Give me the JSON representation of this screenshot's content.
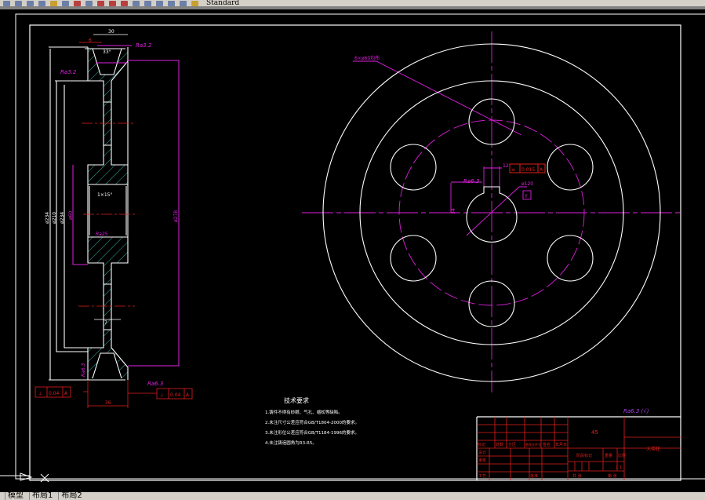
{
  "toolbar": {
    "layer_text": "Standard"
  },
  "tabs": [
    "模型",
    "布局1",
    "布局2"
  ],
  "colors": {
    "white": "#ffffff",
    "magenta": "#e020e0",
    "red": "#e0201c",
    "cyan": "#40e0d0",
    "centerline": "#e0201c",
    "background": "#000000"
  },
  "section_view": {
    "dims": {
      "width_top": "30",
      "groove_offset": "6",
      "groove_angle": "33°",
      "web": "7",
      "width_bottom": "36",
      "bore_chamfer": "1×15°",
      "d1": "ø234",
      "d2": "ø210",
      "d3": "ø234",
      "d4": "ø60",
      "d5": "ø278"
    },
    "roughness": {
      "top_right": "Ra3.2",
      "left": "Ra3.2",
      "bore": "Ra25",
      "groove_left": "Ra6.3",
      "bottom_right": "Ra6.3"
    },
    "tolerance_left": {
      "symbol": "⊥",
      "value": "0.04",
      "datum": "A"
    },
    "tolerance_right": {
      "symbol": "⊥",
      "value": "0.04",
      "datum": "A"
    }
  },
  "front_view": {
    "hole_note": "6×ø60均布",
    "keyway_width": "12",
    "keyway_tolerance": {
      "symbol": "≡",
      "value": "0.015",
      "datum": "A"
    },
    "keyway_depth": "34",
    "bore_roughness": "Ra6.3",
    "bore_dia": "ø120",
    "datum": "Y"
  },
  "notes": {
    "title": "技术要求",
    "items": [
      "1.铸件不得有砂眼、气孔、缩松等缺陷。",
      "2.未注尺寸公差应符合GB/T1804-2000的要求。",
      "3.未注形位公差应符合GB/T1184-1996的要求。",
      "4.未注铸造圆角为R3-R5。"
    ]
  },
  "general_roughness": "Ra6.3 (√)",
  "title_block": {
    "material": "45",
    "part_name": "大带轮",
    "header_row": [
      "标记",
      "处数",
      "分区",
      "更改文件号",
      "签名",
      "年月日"
    ],
    "row_labels": [
      "设计",
      "审核",
      "",
      "工艺"
    ],
    "approve": "批准",
    "stage": "阶段标记",
    "weight": "重量",
    "scale": "比例",
    "scale_value": "1:1",
    "sheets": "共 张",
    "sheet_no": "第 张"
  }
}
